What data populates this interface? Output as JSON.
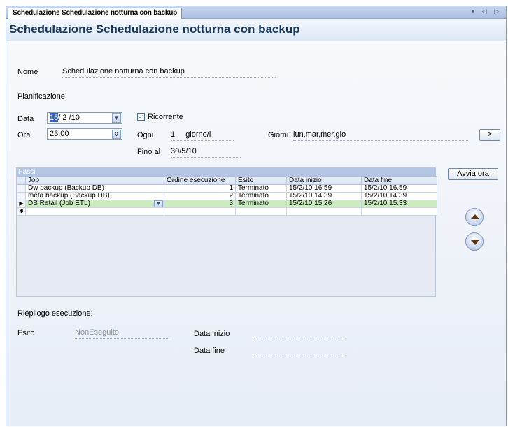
{
  "tab": {
    "label": "Schedulazione Schedulazione notturna con backup",
    "controls": "▾ ◁ ▷"
  },
  "page_title": "Schedulazione Schedulazione notturna con backup",
  "form": {
    "nome_label": "Nome",
    "nome_value": "Schedulazione notturna con backup",
    "pianificazione_label": "Pianificazione:",
    "data_label": "Data",
    "data_day_selected": "15",
    "data_rest": "/ 2 /10",
    "ora_label": "Ora",
    "ora_value": "23.00",
    "ricorrente_label": "Ricorrente",
    "ricorrente_checked": true,
    "ogni_label": "Ogni",
    "ogni_value": "1",
    "giorni_unit": "giorno/i",
    "giorni_label": "Giorni",
    "giorni_value": "lun,mar,mer,gio",
    "giorni_button": ">",
    "fino_al_label": "Fino al",
    "fino_al_value": "30/5/10"
  },
  "avvia_button": "Avvia ora",
  "grid": {
    "caption": "Passi",
    "columns": [
      "Job",
      "Ordine esecuzione",
      "Esito",
      "Data inizio",
      "Data fine"
    ],
    "rows": [
      {
        "marker": "",
        "job": "Dw backup (Backup DB)",
        "ordine": "1",
        "esito": "Terminato",
        "inizio": "15/2/10 16.59",
        "fine": "15/2/10 16.59"
      },
      {
        "marker": "",
        "job": "meta backup (Backup DB)",
        "ordine": "2",
        "esito": "Terminato",
        "inizio": "15/2/10 14.39",
        "fine": "15/2/10 14.39"
      },
      {
        "marker": "▶",
        "job": "DB Retail (Job ETL)",
        "ordine": "3",
        "esito": "Terminato",
        "inizio": "15/2/10 15.26",
        "fine": "15/2/10 15.33"
      },
      {
        "marker": "✱",
        "job": "",
        "ordine": "",
        "esito": "",
        "inizio": "",
        "fine": ""
      }
    ]
  },
  "riepilogo": {
    "title": "Riepilogo esecuzione:",
    "esito_label": "Esito",
    "esito_value": "NonEseguito",
    "data_inizio_label": "Data inizio",
    "data_inizio_value": "",
    "data_fine_label": "Data fine",
    "data_fine_value": ""
  },
  "icons": {
    "move_up": "arrow-up-icon",
    "move_down": "arrow-down-icon",
    "dropdown": "chevron-down-icon"
  }
}
